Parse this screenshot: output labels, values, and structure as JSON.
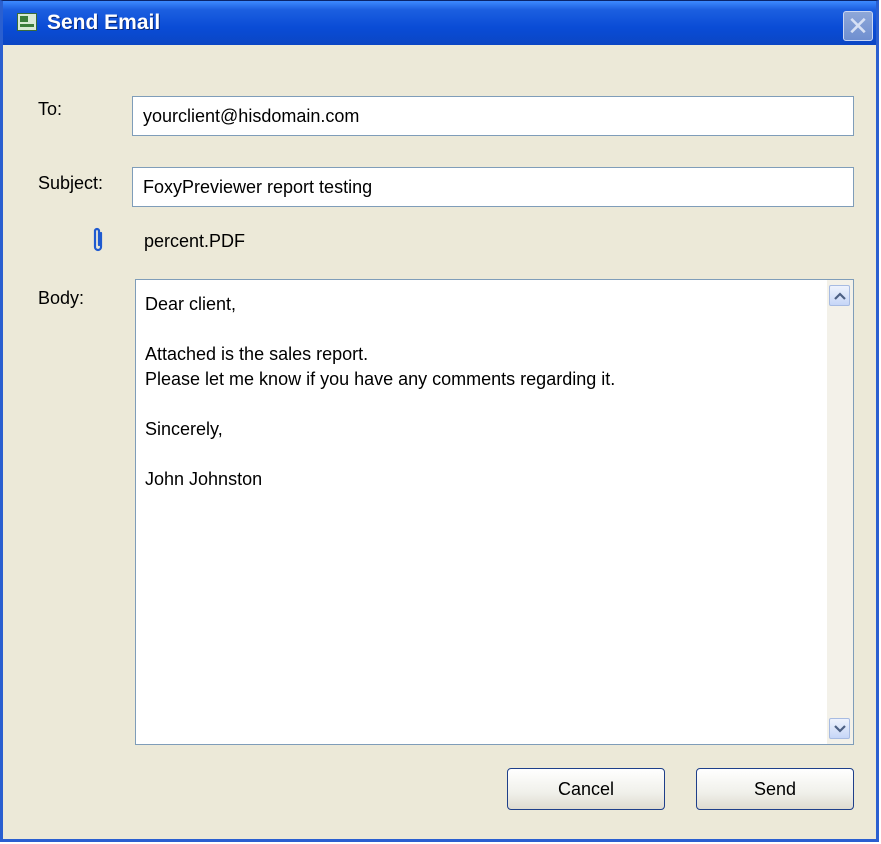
{
  "window": {
    "title": "Send Email",
    "icon": "email-app-icon",
    "close_glyph": "✕"
  },
  "form": {
    "to_label": "To:",
    "to_value": "yourclient@hisdomain.com",
    "subject_label": "Subject:",
    "subject_value": "FoxyPreviewer report testing",
    "attachment_name": "percent.PDF",
    "attachment_icon": "paperclip-icon",
    "body_label": "Body:",
    "body_value": "Dear client,\n\nAttached is the sales report.\nPlease let me know if you have any comments regarding it.\n\nSincerely,\n\nJohn Johnston"
  },
  "buttons": {
    "cancel_label": "Cancel",
    "send_label": "Send"
  },
  "colors": {
    "titlebar": "#0a4cd6",
    "dialog_bg": "#ece9d8",
    "attachment_icon": "#1f5ad0"
  }
}
